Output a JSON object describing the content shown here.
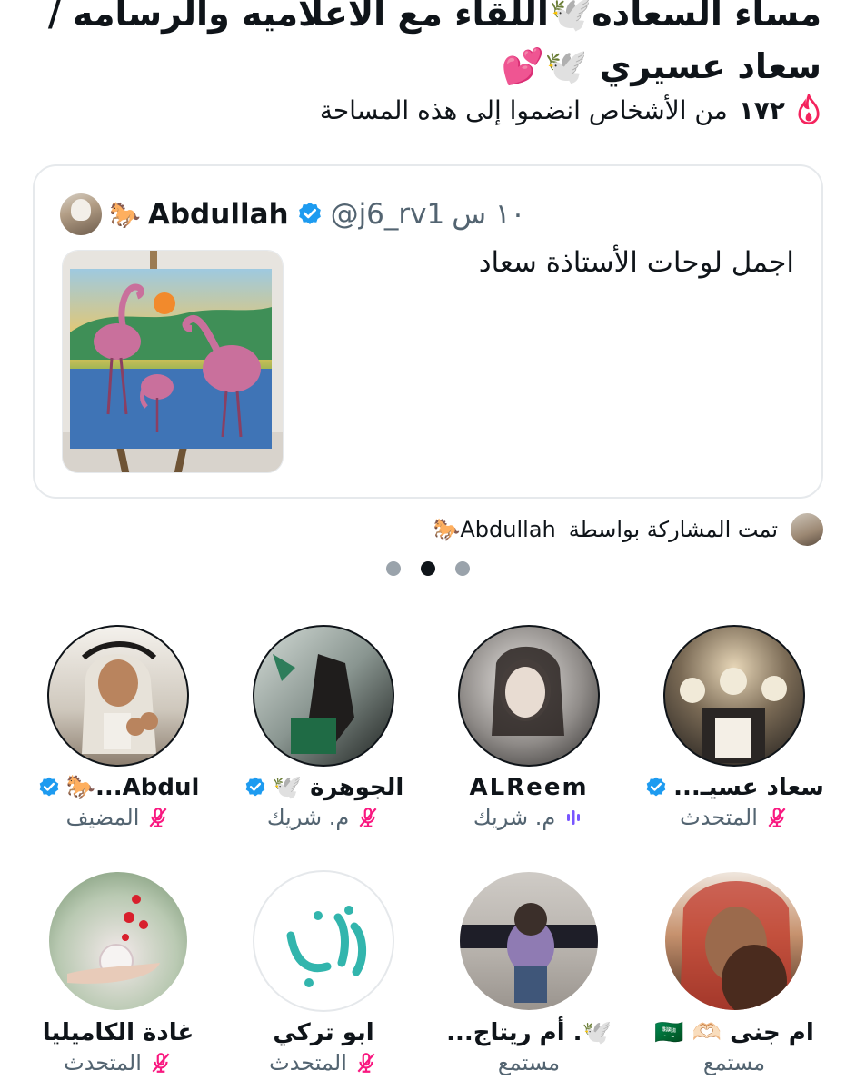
{
  "space": {
    "title": "مساء السعاده🕊️اللقاء مع الاعلاميه والرسامه / سعاد عسيري 🕊️💕",
    "joined_count": "١٧٢",
    "joined_text": "من الأشخاص انضموا إلى هذه المساحة"
  },
  "pinned_tweet": {
    "author_name": "Abdullah",
    "author_emoji": "🐎",
    "handle": "@j6_rv1",
    "time": "١٠ س",
    "text": "اجمل لوحات الأستاذة سعاد"
  },
  "shared_by": {
    "label": "تمت المشاركة بواسطة",
    "name": "Abdullah🐎"
  },
  "pager": {
    "count": 3,
    "active_index": 1
  },
  "participants": [
    {
      "name": "سعاد عسيـ...",
      "role": "المتحدث",
      "verified": true,
      "status_icon": "mic-off-icon"
    },
    {
      "name": "ALReem",
      "role": "م. شريك",
      "verified": false,
      "status_icon": "speaking-icon"
    },
    {
      "name": "الجوهرة 🕊️",
      "role": "م. شريك",
      "verified": true,
      "status_icon": "mic-off-icon"
    },
    {
      "name": "Abdul...🐎",
      "role": "المضيف",
      "verified": true,
      "status_icon": "mic-off-icon"
    },
    {
      "name": "ام جنى 🫶🏻 🇸🇦",
      "role": "مستمع",
      "verified": false,
      "status_icon": ""
    },
    {
      "name": "🕊️. أم ريتاج...",
      "role": "مستمع",
      "verified": false,
      "status_icon": ""
    },
    {
      "name": "ابو تركي",
      "role": "المتحدث",
      "verified": false,
      "status_icon": "mic-off-icon"
    },
    {
      "name": "غادة الكاميليا",
      "role": "المتحدث",
      "verified": false,
      "status_icon": "mic-off-icon"
    }
  ],
  "colors": {
    "mic_off": "#f91880",
    "verified": "#1d9bf0",
    "speaking": "#7856ff",
    "flame": "#f4245e"
  }
}
